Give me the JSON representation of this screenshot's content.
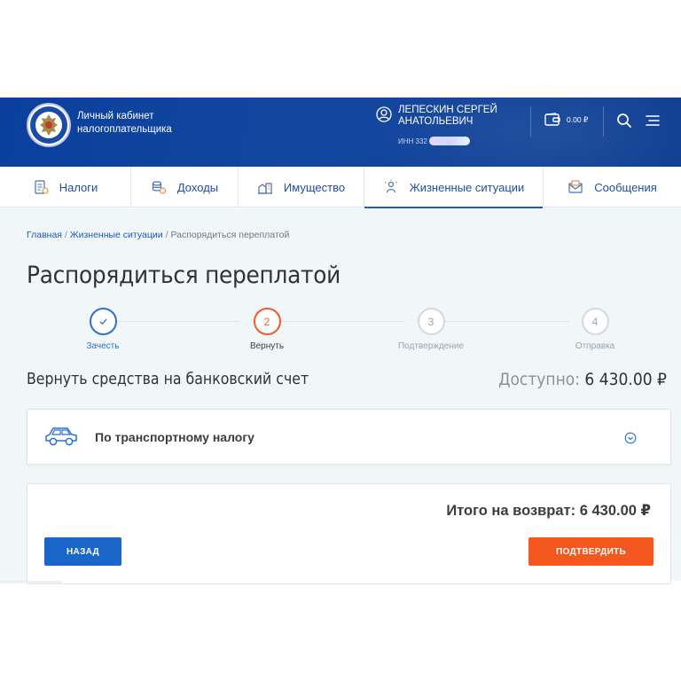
{
  "header": {
    "brand_line1": "Личный кабинет",
    "brand_line2": "налогоплательщика",
    "user_name": "ЛЕПЕСКИН СЕРГЕЙ АНАТОЛЬЕВИЧ",
    "inn_label": "ИНН 332",
    "balance": "0.00 ₽",
    "icons": [
      "user-circle-icon",
      "wallet-icon",
      "search-icon",
      "menu-icon"
    ]
  },
  "nav": {
    "items": [
      {
        "label": "Налоги",
        "icon": "tax-doc-icon"
      },
      {
        "label": "Доходы",
        "icon": "coins-icon"
      },
      {
        "label": "Имущество",
        "icon": "property-icon"
      },
      {
        "label": "Жизненные ситуации",
        "icon": "life-situations-icon",
        "active": true
      },
      {
        "label": "Сообщения",
        "icon": "envelope-icon"
      }
    ]
  },
  "breadcrumb": {
    "home": "Главная",
    "section": "Жизненные ситуации",
    "current": "Распорядиться переплатой"
  },
  "page": {
    "title": "Распорядиться переплатой"
  },
  "steps": [
    {
      "number": "✓",
      "label": "Зачесть",
      "state": "done"
    },
    {
      "number": "2",
      "label": "Вернуть",
      "state": "current"
    },
    {
      "number": "3",
      "label": "Подтверждение",
      "state": "pending"
    },
    {
      "number": "4",
      "label": "Отправка",
      "state": "pending"
    }
  ],
  "section": {
    "title": "Вернуть средства на банковский счет",
    "available_label": "Доступно:",
    "available_value": "6 430.00 ₽"
  },
  "tax_card": {
    "title": "По транспортному налогу",
    "icon": "car-icon"
  },
  "summary": {
    "total": "Итого на возврат: 6 430.00 ₽",
    "back_label": "НАЗАД",
    "confirm_label": "ПОДТВЕРДИТЬ"
  },
  "colors": {
    "header_blue": "#0f4299",
    "accent_blue": "#1b67c9",
    "accent_orange": "#f4581f",
    "background": "#f1f6f9"
  }
}
